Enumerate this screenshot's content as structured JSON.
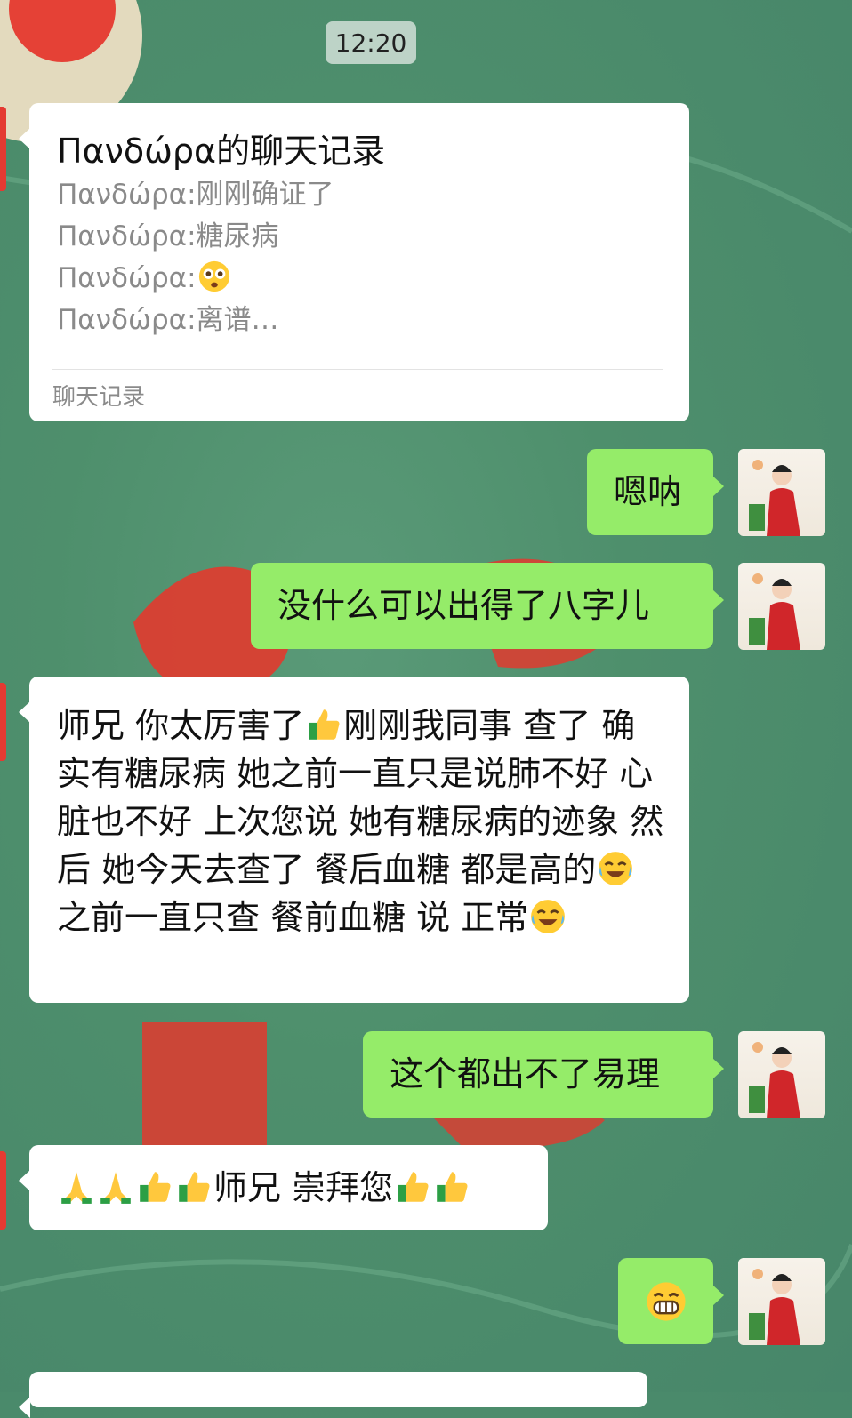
{
  "time": "12:20",
  "record_card": {
    "title": "Πανδώρα的聊天记录",
    "lines": [
      "Πανδώρα:刚刚确证了",
      "Πανδώρα:糖尿病",
      "Πανδώρα:",
      "Πανδώρα:离谱…"
    ],
    "footer": "聊天记录"
  },
  "messages": {
    "m1": "嗯呐",
    "m2": "没什么可以出得了八字儿",
    "m3a": "师兄  你太厉害了",
    "m3b": "刚刚我同事    查了  确实有糖尿病  她之前一直只是说肺不好  心脏也不好    上次您说  她有糖尿病的迹象  然后  她今天去查了  餐后血糖    都是高的",
    "m3c": "之前一直只查  餐前血糖  说  正常",
    "m4": "这个都出不了易理",
    "m5": "师兄  崇拜您"
  },
  "icons": [
    "flushed-face-icon",
    "thumbs-up-icon",
    "laughing-crying-icon",
    "pray-icon",
    "grinning-icon"
  ],
  "colors": {
    "incoming": "#ffffff",
    "outgoing": "#95ec69",
    "background": "#4e8f6c"
  }
}
